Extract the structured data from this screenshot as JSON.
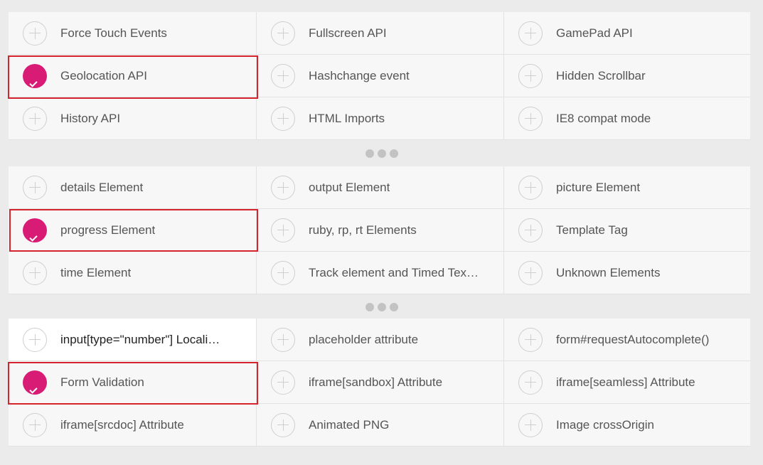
{
  "sections": [
    {
      "items": [
        {
          "label": "Force Touch Events",
          "checked": false
        },
        {
          "label": "Fullscreen API",
          "checked": false
        },
        {
          "label": "GamePad API",
          "checked": false
        },
        {
          "label": "Geolocation API",
          "checked": true
        },
        {
          "label": "Hashchange event",
          "checked": false
        },
        {
          "label": "Hidden Scrollbar",
          "checked": false
        },
        {
          "label": "History API",
          "checked": false
        },
        {
          "label": "HTML Imports",
          "checked": false
        },
        {
          "label": "IE8 compat mode",
          "checked": false
        }
      ]
    },
    {
      "items": [
        {
          "label": "details Element",
          "checked": false
        },
        {
          "label": "output Element",
          "checked": false
        },
        {
          "label": "picture Element",
          "checked": false
        },
        {
          "label": "progress Element",
          "checked": true
        },
        {
          "label": "ruby, rp, rt Elements",
          "checked": false
        },
        {
          "label": "Template Tag",
          "checked": false
        },
        {
          "label": "time Element",
          "checked": false
        },
        {
          "label": "Track element and Timed Tex…",
          "checked": false
        },
        {
          "label": "Unknown Elements",
          "checked": false
        }
      ]
    },
    {
      "items": [
        {
          "label": "input[type=\"number\"] Locali…",
          "checked": false,
          "hover": true
        },
        {
          "label": "placeholder attribute",
          "checked": false
        },
        {
          "label": "form#requestAutocomplete()",
          "checked": false
        },
        {
          "label": "Form Validation",
          "checked": true
        },
        {
          "label": "iframe[sandbox] Attribute",
          "checked": false
        },
        {
          "label": "iframe[seamless] Attribute",
          "checked": false
        },
        {
          "label": "iframe[srcdoc] Attribute",
          "checked": false
        },
        {
          "label": "Animated PNG",
          "checked": false
        },
        {
          "label": "Image crossOrigin",
          "checked": false
        }
      ]
    }
  ],
  "colors": {
    "accent": "#d81b74",
    "highlight_border": "#d6242e",
    "plus_outline": "#cfcfcf",
    "page_background": "#ebebeb",
    "panel_background": "#f7f7f7"
  },
  "icons": {
    "unchecked": "plus-circle-icon",
    "checked": "filled-check-circle-icon",
    "more": "more-dots-icon"
  }
}
